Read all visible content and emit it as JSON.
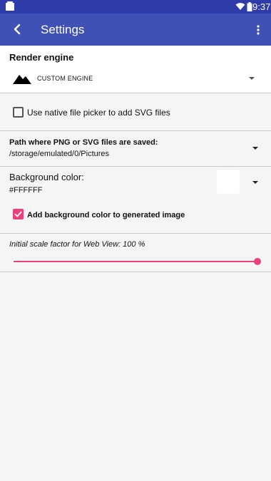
{
  "statusbar": {
    "time": "9:37"
  },
  "appbar": {
    "title": "Settings"
  },
  "render": {
    "heading": "Render engine",
    "engine_label": "CUSTOM ENGINE",
    "engine_icon": "mountain-icon"
  },
  "file_picker": {
    "label": "Use native file picker to add SVG files",
    "checked": false
  },
  "path": {
    "heading": "Path where PNG or SVG files are saved:",
    "value": "/storage/emulated/0/Pictures"
  },
  "background": {
    "heading": "Background color:",
    "value": "#FFFFFF",
    "swatch_color": "#FFFFFF",
    "checkbox_label": "Add background color to generated image",
    "checkbox_checked": true
  },
  "scale": {
    "label": "Initial scale factor for Web View: 100 %",
    "value_fraction": 1.0
  },
  "colors": {
    "statusbar": "#2f3ba9",
    "appbar": "#3f51b5",
    "accent": "#ec407a"
  }
}
